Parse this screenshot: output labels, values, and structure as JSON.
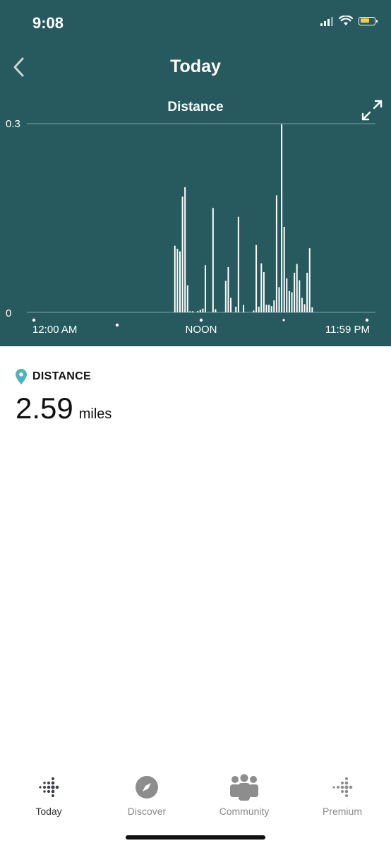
{
  "status_bar": {
    "time": "9:08"
  },
  "header": {
    "title": "Today"
  },
  "colors": {
    "header_bg": "#265a5e",
    "accent_pin": "#4fb0bf",
    "battery": "#f0d338"
  },
  "chart_data": {
    "type": "bar",
    "title": "Distance",
    "ylim": [
      0,
      0.3
    ],
    "y_tick_labels": [
      "0.3",
      "0"
    ],
    "x_tick_labels": [
      "12:00 AM",
      "NOON",
      "11:59 PM"
    ],
    "grid": true,
    "values": [
      0,
      0,
      0,
      0,
      0,
      0,
      0,
      0,
      0,
      0,
      0,
      0,
      0,
      0,
      0,
      0,
      0,
      0,
      0,
      0,
      0,
      0,
      0,
      0,
      0,
      0,
      0,
      0,
      0,
      0,
      0,
      0,
      0,
      0,
      0,
      0,
      0,
      0,
      0,
      0,
      0,
      0,
      0,
      0,
      0,
      0,
      0,
      0,
      0,
      0,
      0,
      0,
      0,
      0,
      0,
      0.106,
      0.101,
      0.097,
      0.184,
      0.199,
      0.043,
      0.001,
      0.001,
      0,
      0.002,
      0.004,
      0.006,
      0.075,
      0,
      0,
      0.166,
      0.005,
      0,
      0,
      0,
      0.05,
      0.072,
      0.023,
      0,
      0.009,
      0.152,
      0,
      0.012,
      0,
      0,
      0,
      0.003,
      0.107,
      0.009,
      0.078,
      0.064,
      0.012,
      0.012,
      0.01,
      0.019,
      0.186,
      0.04,
      0.299,
      0.136,
      0.054,
      0.034,
      0.032,
      0.063,
      0.077,
      0.051,
      0.023,
      0.013,
      0.063,
      0.102,
      0.008,
      0,
      0,
      0,
      0,
      0,
      0,
      0,
      0,
      0,
      0,
      0,
      0,
      0,
      0,
      0,
      0,
      0,
      0,
      0,
      0,
      0
    ]
  },
  "metric": {
    "label": "DISTANCE",
    "value": "2.59",
    "unit": "miles"
  },
  "tabs": [
    {
      "label": "Today",
      "active": true
    },
    {
      "label": "Discover",
      "active": false
    },
    {
      "label": "Community",
      "active": false
    },
    {
      "label": "Premium",
      "active": false
    }
  ]
}
